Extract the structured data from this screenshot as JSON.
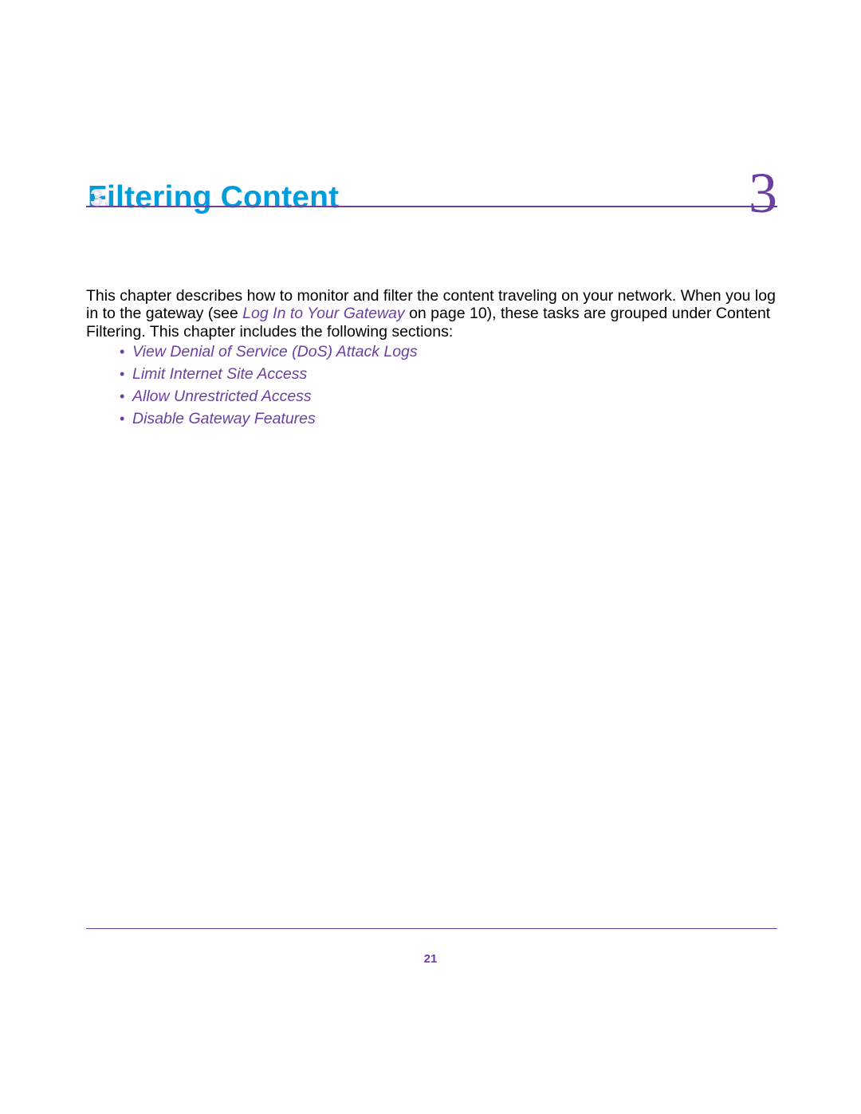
{
  "chapter": {
    "title": "Filtering Content",
    "subtitle": "3.",
    "number": "3"
  },
  "intro": {
    "part1": "This chapter describes how to monitor and filter the content traveling on your network. When you log in to the gateway (see ",
    "link_text": "Log In to Your Gateway",
    "part2": " on page 10), these tasks are grouped under Content Filtering. This chapter includes the following sections:"
  },
  "toc": {
    "items": [
      "View Denial of Service (DoS) Attack Logs",
      "Limit Internet Site Access",
      "Allow Unrestricted Access",
      "Disable Gateway Features"
    ]
  },
  "page_number": "21"
}
